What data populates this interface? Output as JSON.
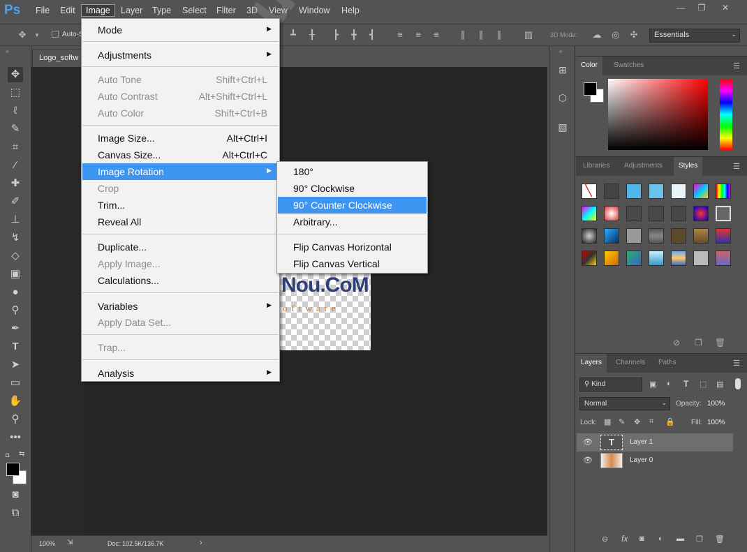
{
  "app": {
    "logo": "Ps"
  },
  "menubar": {
    "items": [
      "File",
      "Edit",
      "Image",
      "Layer",
      "Type",
      "Select",
      "Filter",
      "3D",
      "View",
      "Window",
      "Help"
    ],
    "active": "Image"
  },
  "window_controls": {
    "minimize": "—",
    "restore": "❐",
    "close": "✕"
  },
  "options_bar": {
    "auto_select": "Auto-S",
    "mode_3d": "3D Mode:",
    "workspace": "Essentials"
  },
  "document": {
    "tab": "Logo_softw",
    "image_text": "Nou.CoM",
    "image_subtext": "oftware",
    "zoom": "100%",
    "doc_info": "Doc: 102.5K/136.7K"
  },
  "watermark": "GhaNou.CoM",
  "image_menu": {
    "items": [
      {
        "label": "Mode",
        "shortcut": "",
        "submenu": true,
        "disabled": false
      },
      {
        "label": "Adjustments",
        "shortcut": "",
        "submenu": true,
        "disabled": false
      },
      {
        "label": "Auto Tone",
        "shortcut": "Shift+Ctrl+L",
        "disabled": true
      },
      {
        "label": "Auto Contrast",
        "shortcut": "Alt+Shift+Ctrl+L",
        "disabled": true
      },
      {
        "label": "Auto Color",
        "shortcut": "Shift+Ctrl+B",
        "disabled": true
      },
      {
        "label": "Image Size...",
        "shortcut": "Alt+Ctrl+I",
        "disabled": false
      },
      {
        "label": "Canvas Size...",
        "shortcut": "Alt+Ctrl+C",
        "disabled": false
      },
      {
        "label": "Image Rotation",
        "shortcut": "",
        "submenu": true,
        "highlighted": true
      },
      {
        "label": "Crop",
        "shortcut": "",
        "disabled": true
      },
      {
        "label": "Trim...",
        "shortcut": "",
        "disabled": false
      },
      {
        "label": "Reveal All",
        "shortcut": "",
        "disabled": false
      },
      {
        "label": "Duplicate...",
        "shortcut": "",
        "disabled": false
      },
      {
        "label": "Apply Image...",
        "shortcut": "",
        "disabled": true
      },
      {
        "label": "Calculations...",
        "shortcut": "",
        "disabled": false
      },
      {
        "label": "Variables",
        "shortcut": "",
        "submenu": true,
        "disabled": false
      },
      {
        "label": "Apply Data Set...",
        "shortcut": "",
        "disabled": true
      },
      {
        "label": "Trap...",
        "shortcut": "",
        "disabled": true
      },
      {
        "label": "Analysis",
        "shortcut": "",
        "submenu": true,
        "disabled": false
      }
    ]
  },
  "rotation_menu": {
    "items": [
      {
        "label": "180°"
      },
      {
        "label": "90° Clockwise"
      },
      {
        "label": "90° Counter Clockwise",
        "highlighted": true
      },
      {
        "label": "Arbitrary..."
      },
      {
        "label": "Flip Canvas Horizontal"
      },
      {
        "label": "Flip Canvas Vertical"
      }
    ]
  },
  "color_panel": {
    "tabs": [
      "Color",
      "Swatches"
    ],
    "active": "Color"
  },
  "styles_panel": {
    "tabs": [
      "Libraries",
      "Adjustments",
      "Styles"
    ],
    "active": "Styles"
  },
  "layers_panel": {
    "tabs": [
      "Layers",
      "Channels",
      "Paths"
    ],
    "active": "Layers",
    "filter_kind": "Kind",
    "blend_mode": "Normal",
    "opacity_label": "Opacity:",
    "opacity": "100%",
    "lock_label": "Lock:",
    "fill_label": "Fill:",
    "fill": "100%",
    "layers": [
      {
        "name": "Layer 1",
        "type": "text",
        "selected": true
      },
      {
        "name": "Layer 0",
        "type": "image",
        "selected": false
      }
    ]
  },
  "colors": {
    "accent": "#3d95f2",
    "panel": "#535353",
    "canvas": "#282828"
  }
}
